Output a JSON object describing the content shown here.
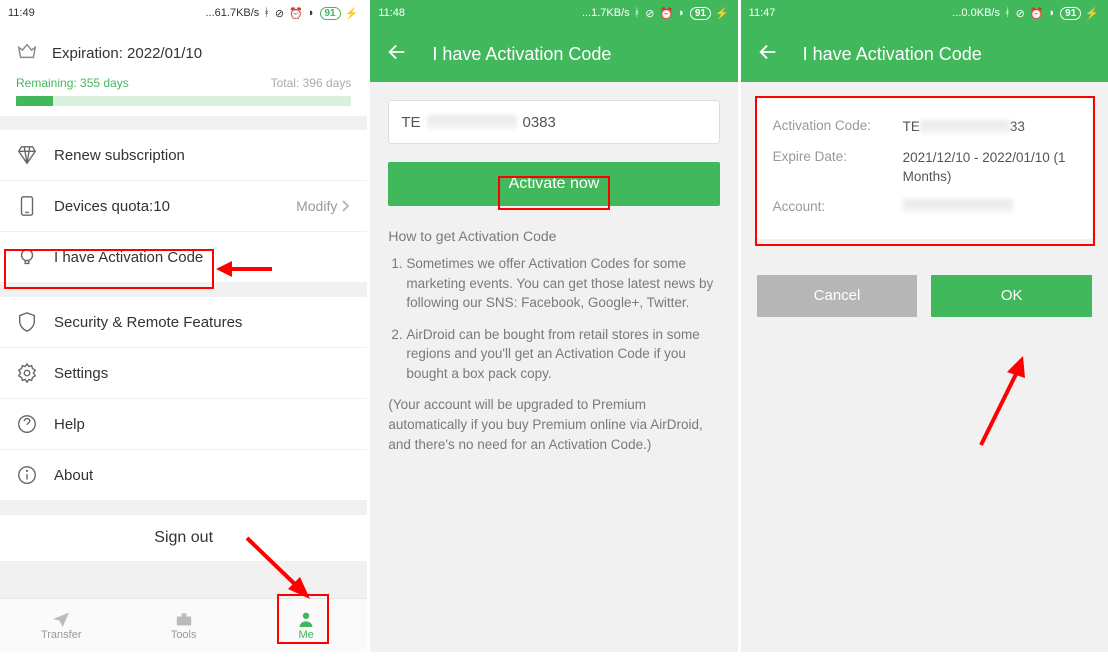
{
  "screen1": {
    "status": {
      "time": "11:49",
      "net": "...61.7KB/s",
      "battery": "91"
    },
    "expiration_label": "Expiration: 2022/01/10",
    "remaining": "Remaining: 355 days",
    "total": "Total: 396 days",
    "items": {
      "renew": "Renew subscription",
      "devices": "Devices quota:10",
      "devices_trailing": "Modify",
      "activation": "I have Activation Code",
      "security": "Security & Remote Features",
      "settings": "Settings",
      "help": "Help",
      "about": "About"
    },
    "signout": "Sign out",
    "nav": {
      "transfer": "Transfer",
      "tools": "Tools",
      "me": "Me"
    }
  },
  "screen2": {
    "status": {
      "time": "11:48",
      "net": "...1.7KB/s",
      "battery": "91"
    },
    "title": "I have Activation Code",
    "code_prefix": "TE",
    "code_suffix": "0383",
    "activate_btn": "Activate now",
    "howto_title": "How to get Activation Code",
    "howto_1": "Sometimes we offer Activation Codes for some marketing events. You can get those latest news by following our SNS: Facebook, Google+, Twitter.",
    "howto_2": "AirDroid can be bought from retail stores in some regions and you'll get an Activation Code if you bought a box pack copy.",
    "howto_note": "(Your account will be upgraded to Premium automatically if you buy Premium online via AirDroid, and there's no need for an Activation Code.)"
  },
  "screen3": {
    "status": {
      "time": "11:47",
      "net": "...0.0KB/s",
      "battery": "91"
    },
    "title": "I have Activation Code",
    "labels": {
      "code": "Activation Code:",
      "expire": "Expire Date:",
      "account": "Account:"
    },
    "values": {
      "code_prefix": "TE",
      "code_suffix": "33",
      "expire": "2021/12/10 - 2022/01/10 (1 Months)"
    },
    "cancel": "Cancel",
    "ok": "OK"
  }
}
